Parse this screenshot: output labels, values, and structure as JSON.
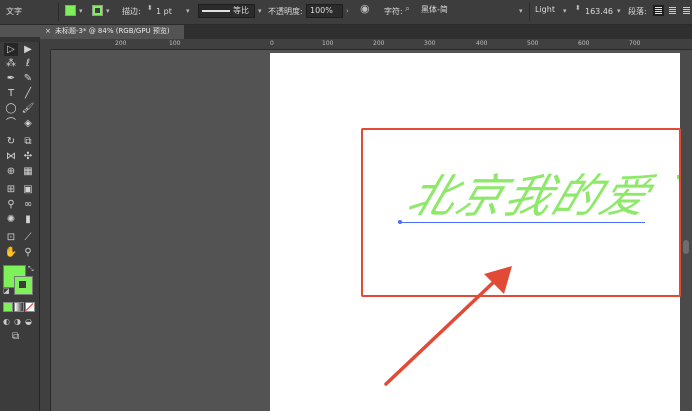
{
  "control_bar": {
    "selection_label": "文字",
    "fill_color": "#7df05a",
    "stroke_color": "#7df05a",
    "stroke_label": "描边:",
    "stroke_weight": "1 pt",
    "profile_label": "等比",
    "opacity_label": "不透明度:",
    "opacity_value": "100%",
    "character_label": "字符:",
    "font_family": "黑体-简",
    "font_style": "Light",
    "font_size": "163.46",
    "paragraph_label": "段落:"
  },
  "document_tab": {
    "title": "未标题-3* @ 84% (RGB/GPU 预览)",
    "close_glyph": "×"
  },
  "ruler_h": {
    "ticks": [
      "200",
      "100",
      "0",
      "100",
      "200",
      "300",
      "400",
      "500",
      "600",
      "700"
    ]
  },
  "canvas": {
    "text": "北京我的爱",
    "text_color": "#8ee86a",
    "annotation_color": "#e24a36"
  }
}
